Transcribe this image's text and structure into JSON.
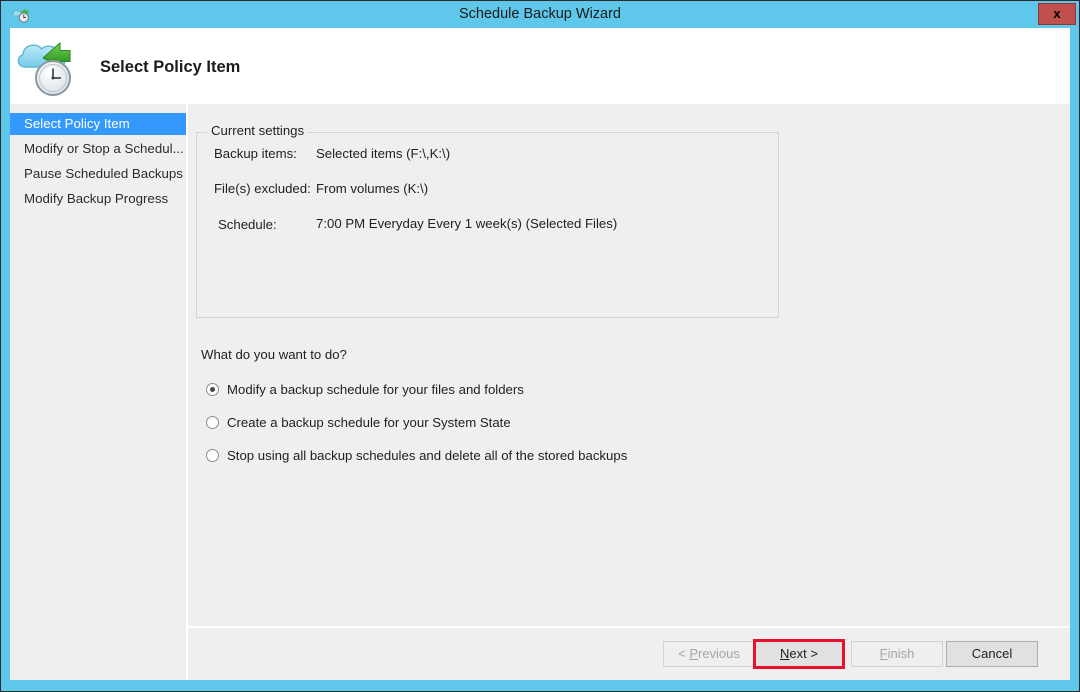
{
  "window": {
    "title": "Schedule Backup Wizard",
    "title_icon": "cloud-clock-icon",
    "close_label": "x",
    "frame_color": "#5fc8ea",
    "titlebar_color": "#5fc8ea",
    "close_button_color": "#c0504d"
  },
  "header": {
    "title": "Select Policy Item",
    "icon": "cloud-backup-schedule-icon"
  },
  "sidebar": {
    "selected_color": "#3399ff",
    "items": [
      {
        "label": "Select Policy Item",
        "selected": true
      },
      {
        "label": "Modify or Stop a Schedul...",
        "selected": false
      },
      {
        "label": "Pause Scheduled Backups",
        "selected": false
      },
      {
        "label": "Modify Backup Progress",
        "selected": false
      }
    ]
  },
  "current_settings": {
    "legend": "Current settings",
    "rows": [
      {
        "label": "Backup items:",
        "value": "Selected items (F:\\,K:\\)"
      },
      {
        "label": "File(s) excluded:",
        "value": "From volumes (K:\\)"
      },
      {
        "label": "Schedule:",
        "value": "7:00 PM Everyday Every 1 week(s) (Selected Files)"
      }
    ]
  },
  "options": {
    "question": "What do you want to do?",
    "choices": [
      {
        "label": "Modify a backup schedule for your files and folders",
        "selected": true
      },
      {
        "label": "Create a backup schedule for your System State",
        "selected": false
      },
      {
        "label": "Stop using all backup schedules and delete all of the stored backups",
        "selected": false
      }
    ]
  },
  "footer": {
    "previous_label": "< Previous",
    "previous_accel": "P",
    "next_label": "Next >",
    "next_accel": "N",
    "finish_label": "Finish",
    "finish_accel": "F",
    "cancel_label": "Cancel",
    "annotation_color": "#e8112d"
  }
}
